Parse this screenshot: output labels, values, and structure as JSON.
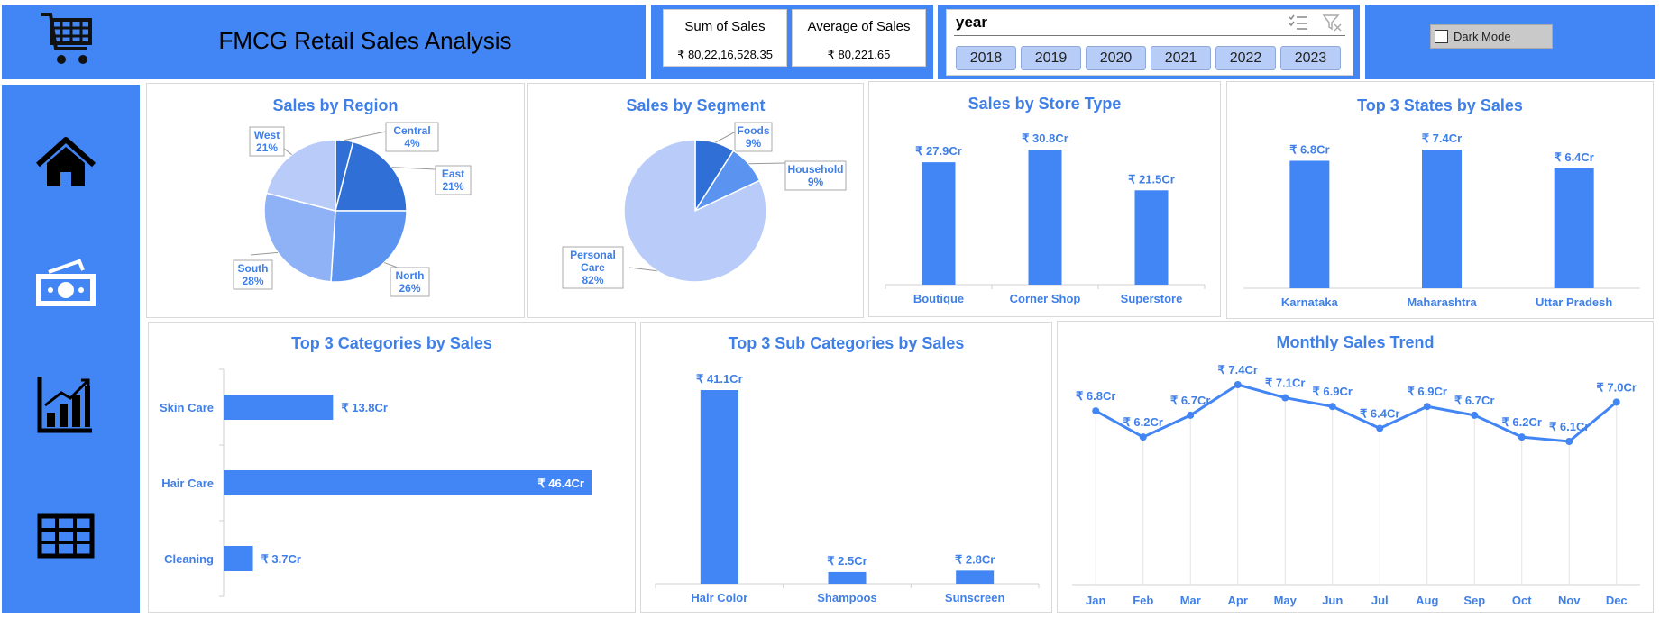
{
  "header": {
    "title": "FMCG Retail Sales Analysis",
    "cart_icon": "shopping-cart-icon"
  },
  "kpis": [
    {
      "label": "Sum of Sales",
      "value": "₹ 80,22,16,528.35"
    },
    {
      "label": "Average of Sales",
      "value": "₹ 80,221.65"
    }
  ],
  "slicer": {
    "title": "year",
    "multi_select_icon": "multi-select-icon",
    "clear_filter_icon": "clear-filter-icon",
    "options": [
      "2018",
      "2019",
      "2020",
      "2021",
      "2022",
      "2023"
    ]
  },
  "dark_mode": {
    "label": "Dark Mode",
    "checked": false
  },
  "sidebar": {
    "items": [
      {
        "icon": "home-icon"
      },
      {
        "icon": "money-icon"
      },
      {
        "icon": "bar-chart-icon"
      },
      {
        "icon": "table-icon"
      }
    ]
  },
  "colors": {
    "accent": "#4285f4",
    "title": "#3f7fe8",
    "pie_dark": "#2f6fd6",
    "pie_mid": "#5b93f0",
    "pie_light": "#8fb2f6",
    "pie_pale": "#b9cbf9"
  },
  "chart_data": [
    {
      "id": "region",
      "type": "pie",
      "title": "Sales by Region",
      "categories": [
        "Central",
        "East",
        "North",
        "South",
        "West"
      ],
      "values": [
        4,
        21,
        26,
        28,
        21
      ],
      "labels": [
        "4%",
        "21%",
        "26%",
        "28%",
        "21%"
      ]
    },
    {
      "id": "segment",
      "type": "pie",
      "title": "Sales by Segment",
      "categories": [
        "Foods",
        "Household",
        "Personal Care"
      ],
      "values": [
        9,
        9,
        82
      ],
      "labels": [
        "9%",
        "9%",
        "82%"
      ]
    },
    {
      "id": "store",
      "type": "bar",
      "title": "Sales by Store Type",
      "categories": [
        "Boutique",
        "Corner Shop",
        "Superstore"
      ],
      "values": [
        27.9,
        30.8,
        21.5
      ],
      "labels": [
        "₹ 27.9Cr",
        "₹ 30.8Cr",
        "₹ 21.5Cr"
      ]
    },
    {
      "id": "states",
      "type": "bar",
      "title": "Top 3 States by Sales",
      "categories": [
        "Karnataka",
        "Maharashtra",
        "Uttar Pradesh"
      ],
      "values": [
        6.8,
        7.4,
        6.4
      ],
      "labels": [
        "₹ 6.8Cr",
        "₹ 7.4Cr",
        "₹ 6.4Cr"
      ]
    },
    {
      "id": "categories",
      "type": "bar",
      "orientation": "horizontal",
      "title": "Top 3 Categories by Sales",
      "categories": [
        "Skin Care",
        "Hair Care",
        "Cleaning"
      ],
      "values": [
        13.8,
        46.4,
        3.7
      ],
      "labels": [
        "₹ 13.8Cr",
        "₹ 46.4Cr",
        "₹ 3.7Cr"
      ]
    },
    {
      "id": "subcategories",
      "type": "bar",
      "title": "Top 3 Sub Categories by Sales",
      "categories": [
        "Hair Color",
        "Shampoos",
        "Sunscreen"
      ],
      "values": [
        41.1,
        2.5,
        2.8
      ],
      "labels": [
        "₹ 41.1Cr",
        "₹ 2.5Cr",
        "₹ 2.8Cr"
      ]
    },
    {
      "id": "monthly",
      "type": "line",
      "title": "Monthly Sales Trend",
      "categories": [
        "Jan",
        "Feb",
        "Mar",
        "Apr",
        "May",
        "Jun",
        "Jul",
        "Aug",
        "Sep",
        "Oct",
        "Nov",
        "Dec"
      ],
      "values": [
        6.8,
        6.2,
        6.7,
        7.4,
        7.1,
        6.9,
        6.4,
        6.9,
        6.7,
        6.2,
        6.1,
        7.0
      ],
      "labels": [
        "₹ 6.8Cr",
        "₹ 6.2Cr",
        "₹ 6.7Cr",
        "₹ 7.4Cr",
        "₹ 7.1Cr",
        "₹ 6.9Cr",
        "₹ 6.4Cr",
        "₹ 6.9Cr",
        "₹ 6.7Cr",
        "₹ 6.2Cr",
        "₹ 6.1Cr",
        "₹ 7.0Cr"
      ],
      "grid": true
    }
  ]
}
